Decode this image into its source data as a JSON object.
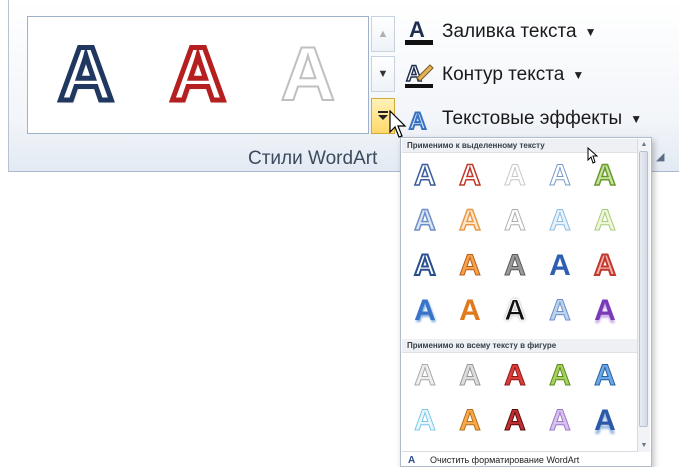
{
  "ribbon": {
    "group_label": "Стили WordArt",
    "gallery": {
      "items": [
        "A",
        "A",
        "A"
      ]
    },
    "commands": [
      {
        "label": "Заливка текста",
        "icon": "text-fill-icon"
      },
      {
        "label": "Контур текста",
        "icon": "text-outline-icon"
      },
      {
        "label": "Текстовые эффекты",
        "icon": "text-effects-icon"
      }
    ]
  },
  "dropdown": {
    "section1": {
      "header": "Применимо к выделенному тексту",
      "rows": [
        [
          "A",
          "A",
          "A",
          "A",
          "A"
        ],
        [
          "A",
          "A",
          "A",
          "A",
          "A"
        ],
        [
          "A",
          "A",
          "A",
          "A",
          "A"
        ],
        [
          "A",
          "A",
          "A",
          "A",
          "A"
        ]
      ]
    },
    "section2": {
      "header": "Применимо ко всему тексту в фигуре",
      "rows": [
        [
          "A",
          "A",
          "A",
          "A",
          "A"
        ],
        [
          "A",
          "A",
          "A",
          "A",
          "A"
        ]
      ]
    },
    "clear_label": "Очистить форматирование WordArt"
  },
  "colors": {
    "accent_blue": "#2a4f8f",
    "accent_red": "#b51f1f",
    "hover_orange": "#ffd86b"
  }
}
